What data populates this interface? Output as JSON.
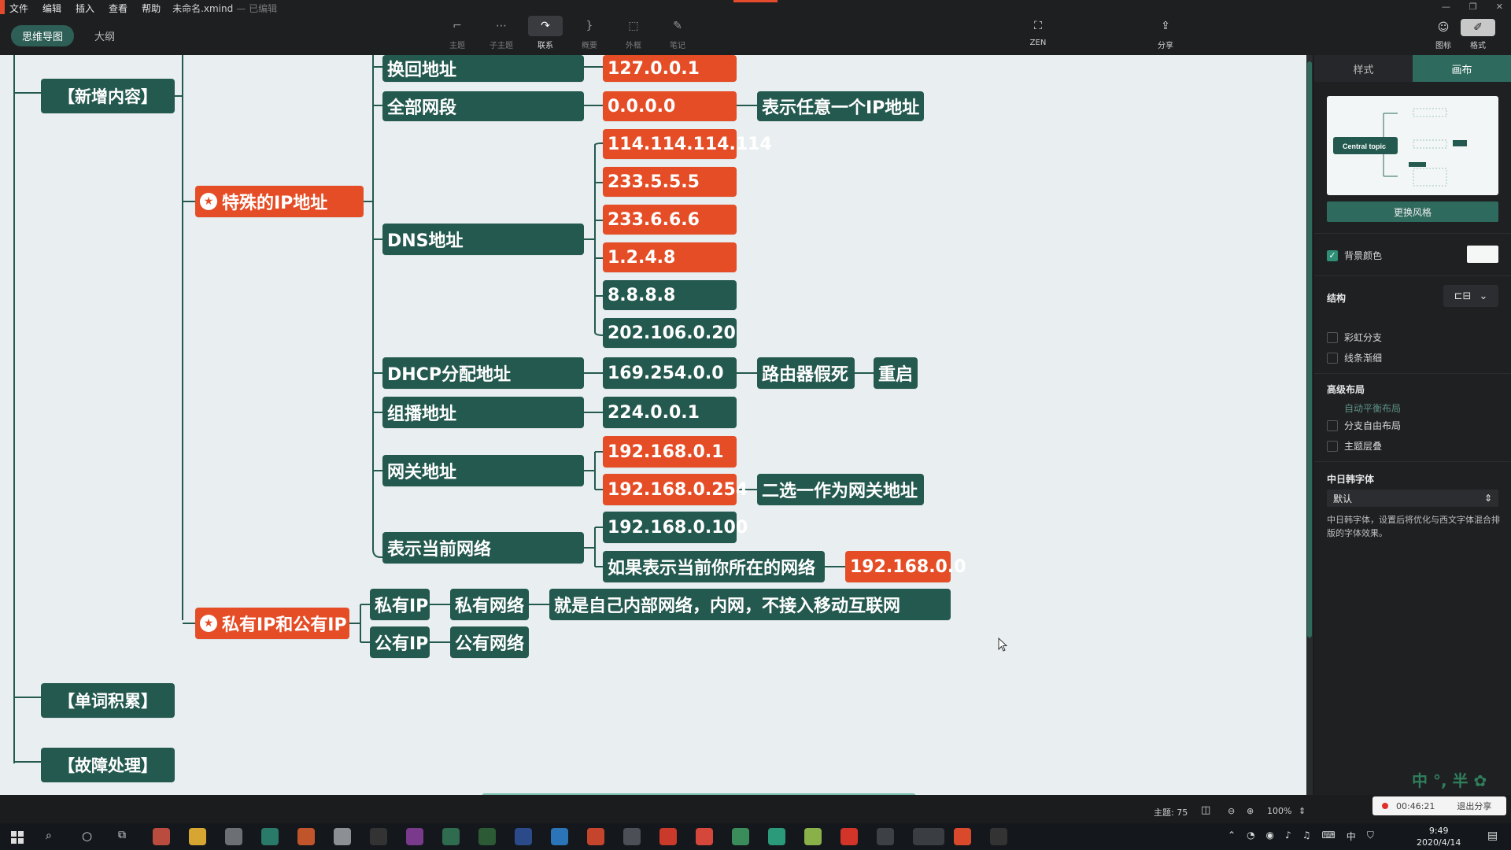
{
  "menu": {
    "items": [
      "文件",
      "编辑",
      "插入",
      "查看",
      "帮助"
    ],
    "filename": "未命名.xmind",
    "saved_state": "— 已编辑"
  },
  "view_tabs": {
    "mindmap": "思维导图",
    "outline": "大纲"
  },
  "toolbar": {
    "topic": "主题",
    "subtopic": "子主题",
    "relation": "联系",
    "summary": "概要",
    "boundary": "外框",
    "note": "笔记",
    "zen": "ZEN",
    "share": "分享",
    "icon": "图标",
    "format": "格式"
  },
  "colors": {
    "green": "#24594f",
    "red": "#e54d26",
    "canvas": "#e9eff1",
    "accent": "#2e6a5e"
  },
  "mindmap": {
    "branches": {
      "new_content": "【新增内容】",
      "special_ip": "特殊的IP地址",
      "private_public": "私有IP和公有IP",
      "word_bank": "【单词积累】",
      "troubleshoot": "【故障处理】"
    },
    "special": {
      "loopback": "换回地址",
      "loopback_ip": "127.0.0.1",
      "all": "全部网段",
      "all_ip": "0.0.0.0",
      "all_note": "表示任意一个IP地址",
      "dns": "DNS地址",
      "dns_ips": [
        "114.114.114.114",
        "233.5.5.5",
        "233.6.6.6",
        "1.2.4.8",
        "8.8.8.8",
        "202.106.0.20"
      ],
      "dhcp": "DHCP分配地址",
      "dhcp_ip": "169.254.0.0",
      "dhcp_note": "路由器假死",
      "dhcp_note2": "重启",
      "multicast": "组播地址",
      "multicast_ip": "224.0.0.1",
      "gateway": "网关地址",
      "gateway_ip1": "192.168.0.1",
      "gateway_ip2": "192.168.0.254",
      "gateway_note": "二选一作为网关地址",
      "current": "表示当前网络",
      "current_ip": "192.168.0.100",
      "current_note": "如果表示当前你所在的网络",
      "current_note_ip": "192.168.0.0"
    },
    "privpub": {
      "private": "私有IP",
      "private_net": "私有网络",
      "private_desc": "就是自己内部网络，内网，不接入移动互联网",
      "public": "公有IP",
      "public_net": "公有网络"
    }
  },
  "status": {
    "topics": "主题: 75",
    "zoom": "100%"
  },
  "panel": {
    "tab_style": "样式",
    "tab_canvas": "画布",
    "preview_central": "Central topic",
    "change_style": "更换风格",
    "bg_color": "背景颜色",
    "structure": "结构",
    "rainbow": "彩虹分支",
    "taper": "线条渐细",
    "advanced": "高级布局",
    "auto_balance": "自动平衡布局",
    "free_branch": "分支自由布局",
    "overlap": "主题层叠",
    "cjk_font": "中日韩字体",
    "font_value": "默认",
    "font_desc": "中日韩字体，设置后将优化与西文字体混合排版的字体效果。"
  },
  "ime": "中 °, 半 ✿",
  "recording": {
    "time": "00:46:21",
    "stop": "退出分享"
  },
  "clock": {
    "time": "9:49",
    "date": "2020/4/14"
  }
}
